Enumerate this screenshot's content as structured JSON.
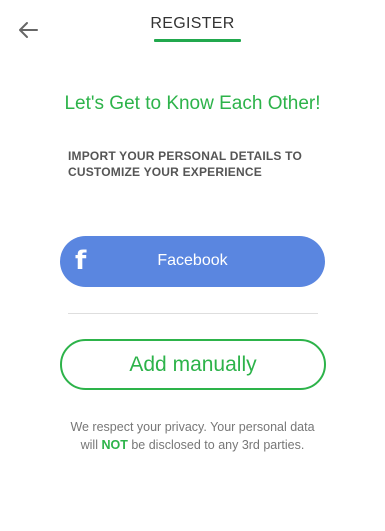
{
  "header": {
    "title": "REGISTER",
    "back_icon": "arrow-left-icon"
  },
  "main": {
    "headline": "Let's Get to Know Each Other!",
    "subtitle_line1": "IMPORT YOUR PERSONAL DETAILS TO",
    "subtitle_line2": "CUSTOMIZE YOUR EXPERIENCE",
    "facebook_button": {
      "icon": "facebook-icon",
      "icon_glyph": "f",
      "label": "Facebook"
    },
    "manual_button": {
      "label": "Add manually"
    },
    "privacy": {
      "line1": "We respect your privacy. Your personal data",
      "line2_prefix": "will ",
      "line2_highlight": "NOT",
      "line2_suffix": " be disclosed to any 3rd parties."
    }
  },
  "colors": {
    "accent_green": "#2db34a",
    "facebook_blue": "#5a86e0",
    "text_gray": "#555555"
  }
}
